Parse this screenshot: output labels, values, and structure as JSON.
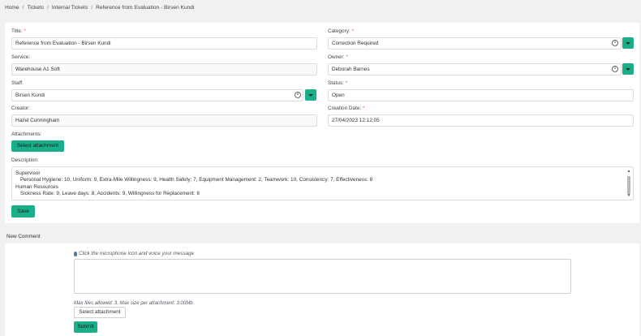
{
  "breadcrumb": {
    "items": [
      "Home",
      "Tickets",
      "Internal Tickets",
      "Reference from Evaluation - Birsen Kundi"
    ],
    "separator": "/"
  },
  "form": {
    "title": {
      "label": "Title:",
      "value": "Reference from Evaluation - Birsen Kundi"
    },
    "category": {
      "label": "Category:",
      "value": "Correction Required"
    },
    "service": {
      "label": "Service:",
      "value": "Warehouse A1 Soft"
    },
    "owner": {
      "label": "Owner:",
      "value": "Deborah Barnes"
    },
    "staff": {
      "label": "Staff:",
      "value": "Birsen Kundi"
    },
    "status": {
      "label": "Status:",
      "value": "Open"
    },
    "creator": {
      "label": "Creator:",
      "value": "Hazel Cunningham"
    },
    "creation_date": {
      "label": "Creation Date:",
      "value": "27/04/2023 12:12:05"
    },
    "attachments": {
      "label": "Attachments:",
      "button": "Select attachment"
    },
    "description": {
      "label": "Description:",
      "lines": [
        "Supervisor",
        "Personal Hygiene: 10, Uniform: 9, Extra-Mile Willingness: 9, Health Safety: 7, Equipment Management: 2, Teamwork: 10, Consistency: 7, Effectiveness: 8",
        "Human Resources",
        "Sickness Rate: 9, Leave days: 8, Accidents: 9, Willingness for Replacement: 8"
      ]
    },
    "required_marker": "*",
    "save_label": "Save",
    "clear_glyph": "×"
  },
  "comment": {
    "section_label": "New Comment",
    "mic_hint": "Click the microphone icon and voice your message",
    "max_files": "Max files allowed: 3. Max size per attachment: 3.00Mb.",
    "select_attachment": "Select attachment",
    "submit_label": "Submit"
  },
  "icons": {
    "clear": "x-circle-icon",
    "dropdown": "chevron-down-icon",
    "microphone": "microphone-icon",
    "scroll_up": "▲",
    "scroll_down": "▼"
  },
  "colors": {
    "accent": "#1aaf8b",
    "required": "#e05a5a",
    "page_bg": "#f1f1f1"
  }
}
